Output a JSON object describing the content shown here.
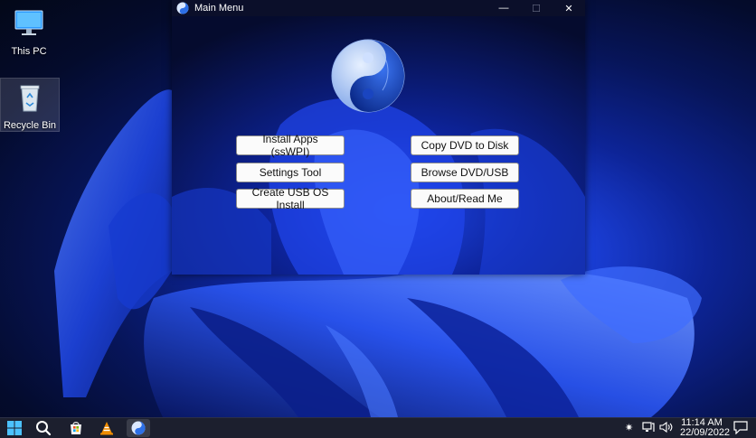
{
  "desktop": {
    "icons": [
      {
        "label": "This PC"
      },
      {
        "label": "Recycle Bin"
      }
    ]
  },
  "window": {
    "title": "Main Menu",
    "controls": {
      "minimize": "—",
      "maximize": "☐",
      "close": "✕"
    },
    "buttons": {
      "install_apps": "Install Apps (ssWPI)",
      "settings_tool": "Settings Tool",
      "create_usb": "Create USB OS Install",
      "copy_dvd": "Copy DVD to Disk",
      "browse_dvd": "Browse DVD/USB",
      "about": "About/Read Me"
    }
  },
  "taskbar": {
    "icons": [
      "windows-start-icon",
      "search-icon",
      "store-icon",
      "vlc-icon",
      "yin-yang-app-icon"
    ],
    "tray": [
      "brightness-icon",
      "network-icon",
      "volume-icon"
    ],
    "clock": {
      "time": "11:14 AM",
      "date": "22/09/2022"
    }
  },
  "colors": {
    "accent": "#2f5cff",
    "taskbar": "#1c1f2e",
    "window_title": "#0b0f2a"
  }
}
